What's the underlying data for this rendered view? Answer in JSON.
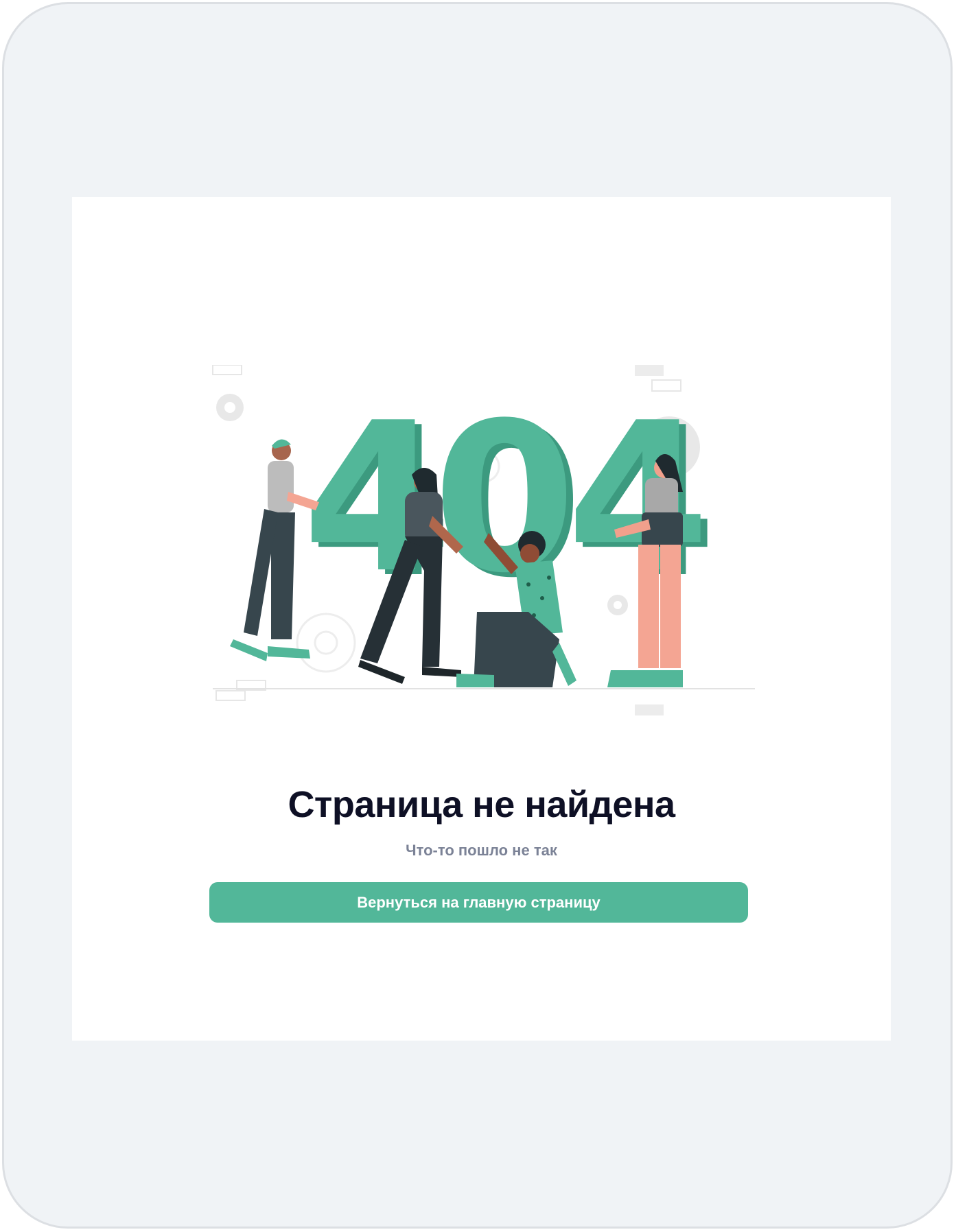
{
  "page": {
    "title": "Страница не найдена",
    "subtitle": "Что-то пошло не так",
    "button_label": "Вернуться на главную страницу"
  },
  "illustration": {
    "big_text": [
      "4",
      "0",
      "4"
    ],
    "accent_color": "#52b799",
    "icons": [
      "gear-icon"
    ]
  },
  "colors": {
    "background": "#f0f3f6",
    "card": "#ffffff",
    "title": "#0e1025",
    "subtitle": "#7b8296",
    "button": "#52b799",
    "button_text": "#ffffff"
  }
}
